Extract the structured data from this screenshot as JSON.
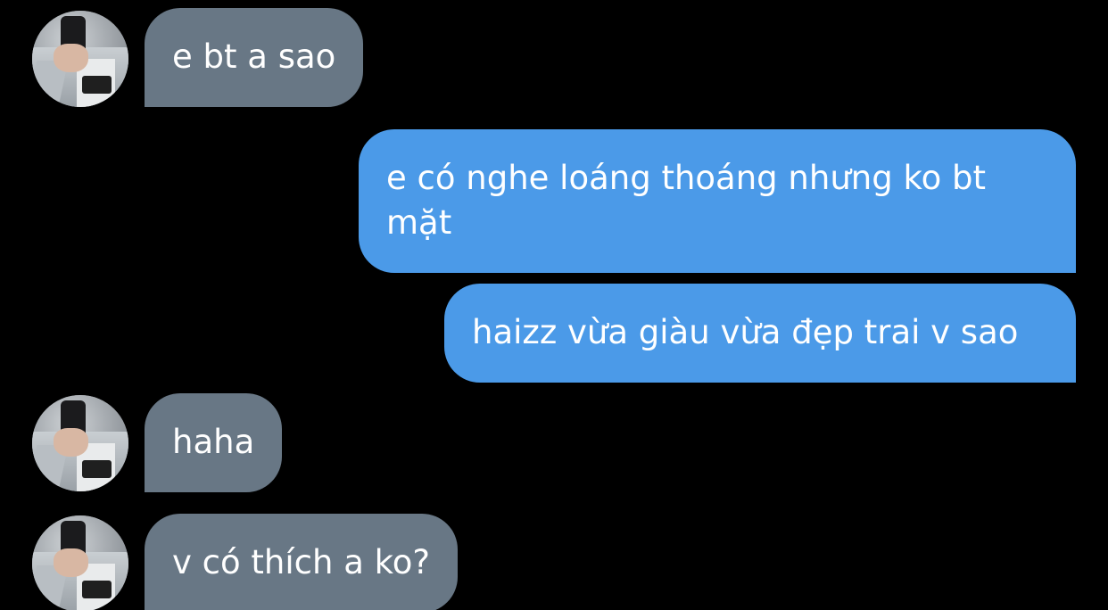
{
  "chat": {
    "colors": {
      "background": "#000000",
      "incoming_bubble": "#687785",
      "outgoing_bubble": "#4b9ae8",
      "text": "#ffffff"
    },
    "messages": [
      {
        "direction": "incoming",
        "text": "e bt a sao",
        "has_avatar": true,
        "avatar_icon": "contact-avatar"
      },
      {
        "direction": "outgoing",
        "text": "e có nghe loáng thoáng nhưng ko bt mặt"
      },
      {
        "direction": "outgoing",
        "text": "haizz vừa giàu vừa đẹp trai v sao"
      },
      {
        "direction": "incoming",
        "text": "haha",
        "has_avatar": true,
        "avatar_icon": "contact-avatar"
      },
      {
        "direction": "incoming",
        "text": "v có thích a ko?",
        "has_avatar": true,
        "avatar_icon": "contact-avatar"
      }
    ]
  }
}
